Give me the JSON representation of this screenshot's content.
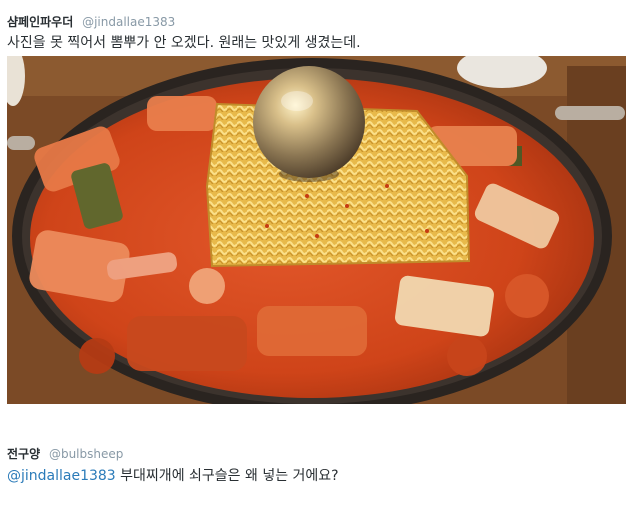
{
  "tweets": [
    {
      "display_name": "샴페인파우더",
      "handle": "@jindallae1383",
      "text": "사진을 못 찍어서 뽐뿌가 안 오겠다. 원래는 맛있게 생겼는데.",
      "photo": {
        "subject": "budae-jjigae-photo",
        "colors": {
          "broth": "#d9481c",
          "pot": "#2a2420",
          "noodles": "#f0c760",
          "ladle": "#a9916b",
          "table": "#7b4a26"
        }
      }
    },
    {
      "display_name": "전구양",
      "handle": "@bulbsheep",
      "reply_mention": "@jindallae1383",
      "reply_text": "부대찌개에 쇠구슬은 왜 넣는 거에요?"
    }
  ],
  "colors": {
    "text": "#292f33",
    "muted": "#8899a6",
    "link": "#2b7bb9",
    "background": "#ffffff"
  }
}
